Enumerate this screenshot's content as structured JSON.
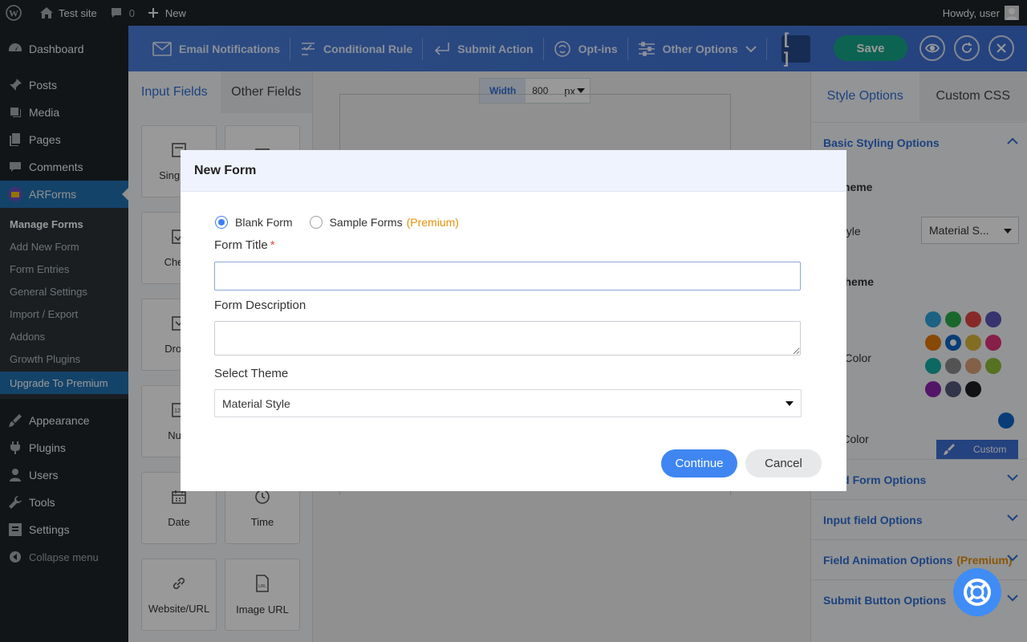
{
  "admin_bar": {
    "site_name": "Test site",
    "comments_count": "0",
    "new_label": "New",
    "greeting": "Howdy, user"
  },
  "sidebar": {
    "dashboard": "Dashboard",
    "posts": "Posts",
    "media": "Media",
    "pages": "Pages",
    "comments": "Comments",
    "arforms": "ARForms",
    "submenu": [
      "Manage Forms",
      "Add New Form",
      "Form Entries",
      "General Settings",
      "Import / Export",
      "Addons",
      "Growth Plugins",
      "Upgrade To Premium"
    ],
    "appearance": "Appearance",
    "plugins": "Plugins",
    "users": "Users",
    "tools": "Tools",
    "settings": "Settings",
    "collapse": "Collapse menu"
  },
  "toolbar": {
    "email_notifications": "Email Notifications",
    "conditional_rule": "Conditional Rule",
    "submit_action": "Submit Action",
    "opt_ins": "Opt-ins",
    "other_options": "Other Options",
    "bracket": "[ ]",
    "save": "Save"
  },
  "left_panel": {
    "tab_input": "Input Fields",
    "tab_other": "Other Fields",
    "fields": [
      "Single Li",
      "Check",
      "Dropo",
      "Num",
      "Date",
      "Time",
      "Website/URL",
      "Image URL"
    ]
  },
  "canvas": {
    "width_label": "Width",
    "width_value": "800",
    "width_unit": "px"
  },
  "right_panel": {
    "tab_style": "Style Options",
    "tab_css": "Custom CSS",
    "basic_styling": "Basic Styling Options",
    "select_theme": "ct Theme",
    "input_style": "ut Style",
    "input_style_value": "Material S...",
    "color_scheme": "r Scheme",
    "choose_color": "ose Color",
    "custom_color": "om Color",
    "custom_btn": "Custom",
    "advanced": "nced Form Options",
    "input_field": "Input field Options",
    "field_animation": "Field Animation Options",
    "premium": "(Premium)",
    "submit_button": "Submit Button Options",
    "colors": {
      "row1": [
        "#2ea3da",
        "#2cac4c",
        "#e24545",
        "#5b56b8"
      ],
      "row2": [
        "#e3780b",
        "#1066c8",
        "#dbb63a",
        "#e0357a"
      ],
      "row3": [
        "#17aea4",
        "#8a8a8a",
        "#dba179",
        "#8fbc3a"
      ],
      "row4": [
        "#8c24b0",
        "#54577a",
        "#1f1f22"
      ],
      "custom": "#1066c8"
    }
  },
  "modal": {
    "title": "New Form",
    "blank_form": "Blank Form",
    "sample_forms": "Sample Forms",
    "premium": "(Premium)",
    "form_title_label": "Form Title",
    "required_mark": "*",
    "form_title_value": "",
    "form_description_label": "Form Description",
    "form_description_value": "",
    "select_theme_label": "Select Theme",
    "theme_value": "Material Style",
    "continue": "Continue",
    "cancel": "Cancel"
  }
}
